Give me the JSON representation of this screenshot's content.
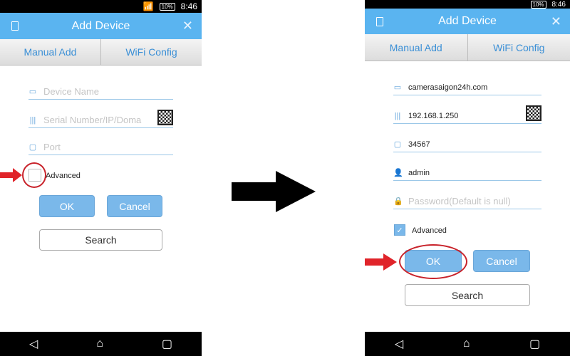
{
  "left": {
    "status": {
      "time": "8:46",
      "battery": "10%"
    },
    "header": {
      "title": "Add Device"
    },
    "tabs": [
      {
        "label": "Manual Add"
      },
      {
        "label": "WiFi Config"
      }
    ],
    "fields": {
      "device_name_placeholder": "Device Name",
      "serial_placeholder": "Serial Number/IP/Doma",
      "port_placeholder": "Port"
    },
    "advanced": {
      "label": "Advanced",
      "checked": false
    },
    "ok": "OK",
    "cancel": "Cancel",
    "search": "Search"
  },
  "right": {
    "status": {
      "time": "8:46",
      "battery": "10%"
    },
    "header": {
      "title": "Add Device"
    },
    "tabs": [
      {
        "label": "Manual Add"
      },
      {
        "label": "WiFi Config"
      }
    ],
    "fields": {
      "device_name": "camerasaigon24h.com",
      "serial": "192.168.1.250",
      "port": "34567",
      "username": "admin",
      "password_placeholder": "Password(Default is null)"
    },
    "advanced": {
      "label": "Advanced",
      "checked": true
    },
    "ok": "OK",
    "cancel": "Cancel",
    "search": "Search"
  },
  "colors": {
    "accent": "#5ab4f0",
    "highlight": "#c8222a"
  }
}
